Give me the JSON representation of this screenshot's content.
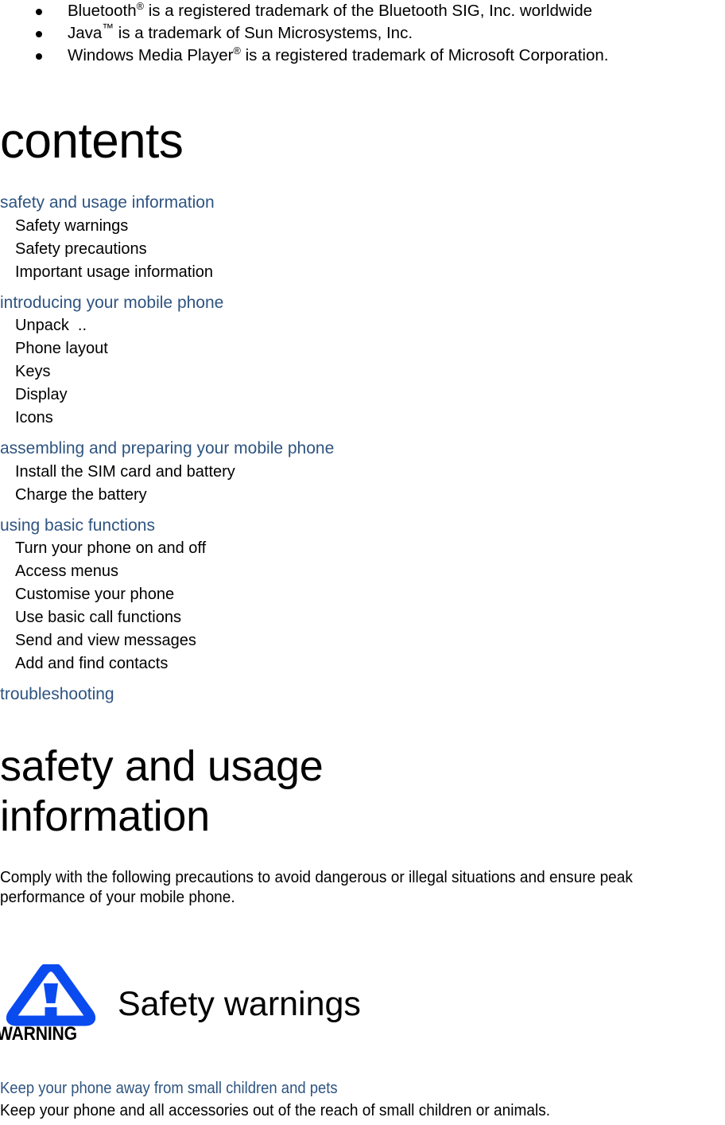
{
  "trademarks": {
    "items": [
      {
        "pre": "Bluetooth",
        "sup": "®",
        "sup_kind": "reg",
        "post": " is a registered trademark of the Bluetooth SIG, Inc. worldwide"
      },
      {
        "pre": "Java",
        "sup": "™",
        "sup_kind": "tm",
        "post": " is a trademark of Sun Microsystems, Inc."
      },
      {
        "pre": "Windows Media Player",
        "sup": "®",
        "sup_kind": "reg",
        "post": " is a registered trademark of Microsoft Corporation."
      }
    ]
  },
  "contents": {
    "title": "contents",
    "groups": [
      {
        "heading": "safety and usage information",
        "entries": [
          "Safety warnings",
          "Safety precautions",
          "Important usage information"
        ]
      },
      {
        "heading": "introducing your mobile phone",
        "entries": [
          "Unpack  ..",
          "Phone layout",
          "Keys",
          "Display",
          "Icons"
        ]
      },
      {
        "heading": "assembling and preparing your mobile phone",
        "entries": [
          "Install the SIM card and battery",
          "Charge the battery"
        ]
      },
      {
        "heading": "using basic functions",
        "entries": [
          "Turn your phone on and off",
          "Access menus",
          "Customise your phone",
          "Use basic call functions",
          "Send and view messages",
          "Add and find contacts"
        ]
      },
      {
        "heading": "troubleshooting",
        "entries": []
      }
    ]
  },
  "chapter": {
    "title": "safety and usage information",
    "intro": "Comply with the following precautions to avoid dangerous or illegal situations and ensure peak performance of your mobile phone."
  },
  "warning_section": {
    "icon_label": "WARNING",
    "heading": "Safety warnings",
    "icon_color": "#0A4BF0",
    "tip_heading": "Keep your phone away from small children and pets",
    "tip_body": "Keep your phone and all accessories out of the reach of small children or animals."
  },
  "colors": {
    "heading_blue": "#2E5481",
    "text_black": "#000000",
    "page_background": "#ffffff"
  }
}
